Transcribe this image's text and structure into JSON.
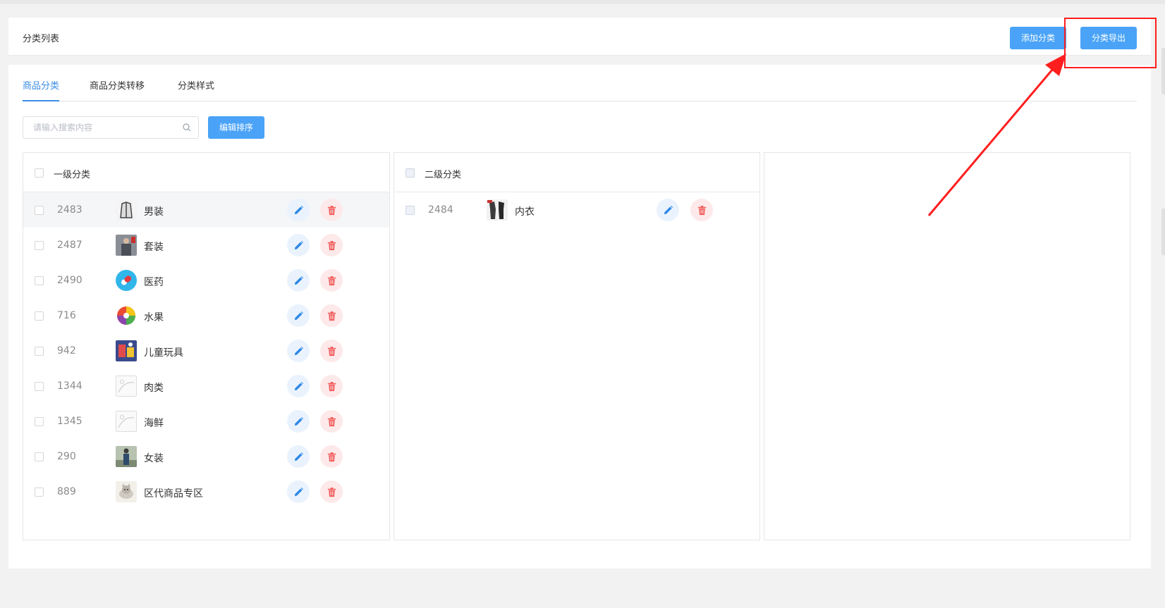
{
  "header": {
    "title": "分类列表",
    "add_label": "添加分类",
    "export_label": "分类导出"
  },
  "tabs": [
    {
      "label": "商品分类",
      "active": true
    },
    {
      "label": "商品分类转移",
      "active": false
    },
    {
      "label": "分类样式",
      "active": false
    }
  ],
  "search": {
    "placeholder": "请输入搜索内容",
    "value": ""
  },
  "sort_label": "编辑排序",
  "level1": {
    "title": "一级分类",
    "items": [
      {
        "id": "2483",
        "name": "男装",
        "thumb": "coat-thumbnail"
      },
      {
        "id": "2487",
        "name": "套装",
        "thumb": "suit-thumbnail"
      },
      {
        "id": "2490",
        "name": "医药",
        "thumb": "pill-thumbnail"
      },
      {
        "id": "716",
        "name": "水果",
        "thumb": "fruit-thumbnail"
      },
      {
        "id": "942",
        "name": "儿童玩具",
        "thumb": "toy-thumbnail"
      },
      {
        "id": "1344",
        "name": "肉类",
        "thumb": "image-placeholder"
      },
      {
        "id": "1345",
        "name": "海鲜",
        "thumb": "image-placeholder"
      },
      {
        "id": "290",
        "name": "女装",
        "thumb": "women-thumbnail"
      },
      {
        "id": "889",
        "name": "区代商品专区",
        "thumb": "cat-thumbnail"
      }
    ]
  },
  "level2": {
    "title": "二级分类",
    "items": [
      {
        "id": "2484",
        "name": "内衣",
        "thumb": "underwear-thumbnail"
      }
    ]
  },
  "colors": {
    "primary": "#4aa3f7",
    "tab_active": "#3a8ee6",
    "edit": "#2f88e6",
    "delete": "#f25b5b",
    "annotation": "#ff1e1e"
  }
}
